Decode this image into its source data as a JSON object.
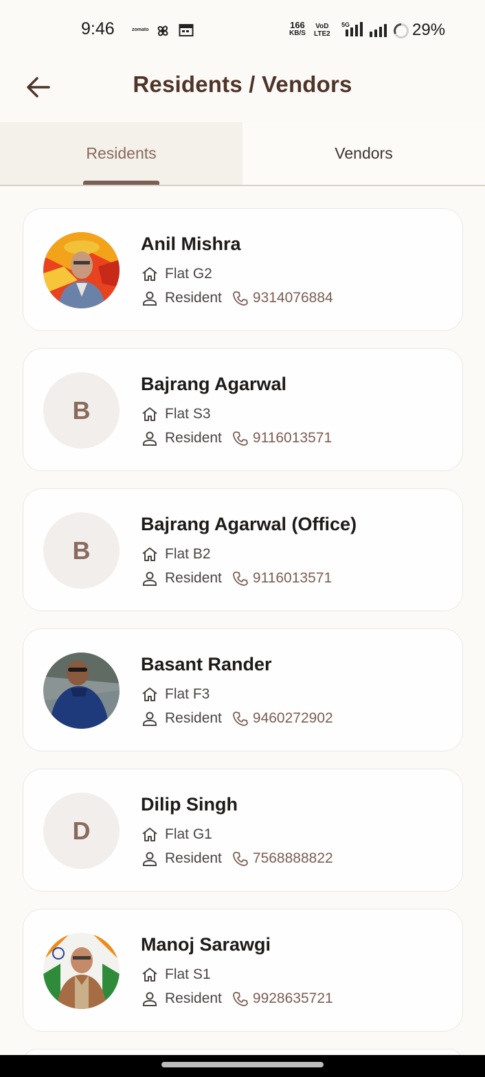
{
  "status_bar": {
    "time": "9:46",
    "zomato": "zomato",
    "speed_value": "166",
    "speed_unit": "KB/S",
    "volte_top": "VoD",
    "volte_bottom": "LTE2",
    "network": "5G",
    "battery": "29%"
  },
  "app_bar": {
    "title": "Residents / Vendors"
  },
  "tabs": {
    "residents": "Residents",
    "vendors": "Vendors",
    "active": "residents"
  },
  "colors": {
    "accent": "#7b5e53",
    "title": "#4e3429",
    "background": "#fcfaf7"
  },
  "residents": [
    {
      "name": "Anil Mishra",
      "flat": "Flat G2",
      "role": "Resident",
      "phone": "9314076884",
      "avatar": "photo"
    },
    {
      "name": "Bajrang Agarwal",
      "flat": "Flat S3",
      "role": "Resident",
      "phone": "9116013571",
      "avatar": "B"
    },
    {
      "name": "Bajrang Agarwal (Office)",
      "flat": "Flat B2",
      "role": "Resident",
      "phone": "9116013571",
      "avatar": "B"
    },
    {
      "name": "Basant Rander",
      "flat": "Flat F3",
      "role": "Resident",
      "phone": "9460272902",
      "avatar": "photo"
    },
    {
      "name": "Dilip Singh",
      "flat": "Flat G1",
      "role": "Resident",
      "phone": "7568888822",
      "avatar": "D"
    },
    {
      "name": "Manoj Sarawgi",
      "flat": "Flat S1",
      "role": "Resident",
      "phone": "9928635721",
      "avatar": "photo"
    }
  ]
}
